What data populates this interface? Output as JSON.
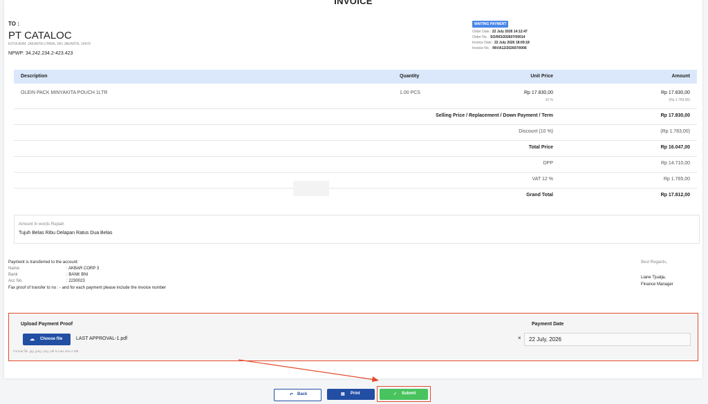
{
  "invoice": {
    "title": "INVOICE",
    "to_label": "TO :",
    "company": "PT CATALOC",
    "address": "KOTA ADM. JAKARTA UTARA, DKI JAKARTA, 14470",
    "npwp": "NPWP: 34.242.234.2-423.423",
    "status_badge": "WAITING PAYMENT",
    "meta": [
      {
        "label": "Order Date : ",
        "value": "22 July 2026 14:12:47"
      },
      {
        "label": "Order No. : ",
        "value": "SO/003/202607/00014"
      },
      {
        "label": "Invoice Date : ",
        "value": "22 July 2026 18:09:18"
      },
      {
        "label": "Invoice No. : ",
        "value": "INV/A12/202607/0006"
      }
    ]
  },
  "table": {
    "headers": {
      "description": "Description",
      "quantity": "Quantity",
      "unit_price": "Unit Price",
      "amount": "Amount"
    },
    "items": [
      {
        "description": "OLEIN PACK MINYAKITA POUCH 1LTR",
        "quantity": "1.00 PCS",
        "unit_price": "Rp 17.830,00",
        "discount": "10 %",
        "amount": "Rp 17.830,00",
        "amount_discount": "(Rp 1.783,00)"
      }
    ],
    "summary": [
      {
        "label": "Selling Price / Replacement / Down Payment / Term",
        "value": "Rp 17.830,00"
      },
      {
        "label": "Discount (10 %)",
        "value": "(Rp 1.783,00)"
      },
      {
        "label": "Total Price",
        "value": "Rp 16.047,00"
      },
      {
        "label": "DPP",
        "value": "Rp 14.710,00"
      },
      {
        "label": "VAT 12 %",
        "value": "Rp 1.765,00"
      },
      {
        "label": "Grand Total",
        "value": "Rp 17.812,00"
      }
    ]
  },
  "amount_words": {
    "label": "Amount In words Rupiah",
    "text": "Tujuh Belas Ribu Delapan Ratus Dua Belas"
  },
  "payment": {
    "intro": "Payment is transferred to the account:",
    "name_label": "Name",
    "name_value": ": AKBAR CORP 3",
    "bank_label": "Bank",
    "bank_value": ": BANK BNI",
    "acc_label": "Acc No.",
    "acc_value": ": 2230023",
    "fax_note": "Fax proof of transfer to no : - and for each payment please include the invoice number"
  },
  "signature": {
    "regards": "Best Regards,",
    "name": "Liane Tjuatja,",
    "position": "Finance Manager"
  },
  "upload": {
    "label": "Upload Payment Proof",
    "choose_label": "Choose file",
    "file_name": "LAST APPROVAL-1.pdf",
    "clear_icon": "×",
    "hint": "Format file .jpg .jpeg .png .pdf & max size 2 MB",
    "date_label": "Payment Date",
    "date_value": "22 July, 2026"
  },
  "buttons": {
    "back": "Back",
    "print": "Print",
    "submit": "Submit"
  },
  "icons": {
    "back": "undo-arrow-icon",
    "print": "printer-icon",
    "submit": "check-icon",
    "choose": "cloud-upload-icon"
  },
  "colors": {
    "primary": "#224ea4",
    "success": "#48c35d",
    "highlight": "#e24a2a",
    "table_header": "#dbe8fb",
    "badge": "#4a86e8"
  }
}
